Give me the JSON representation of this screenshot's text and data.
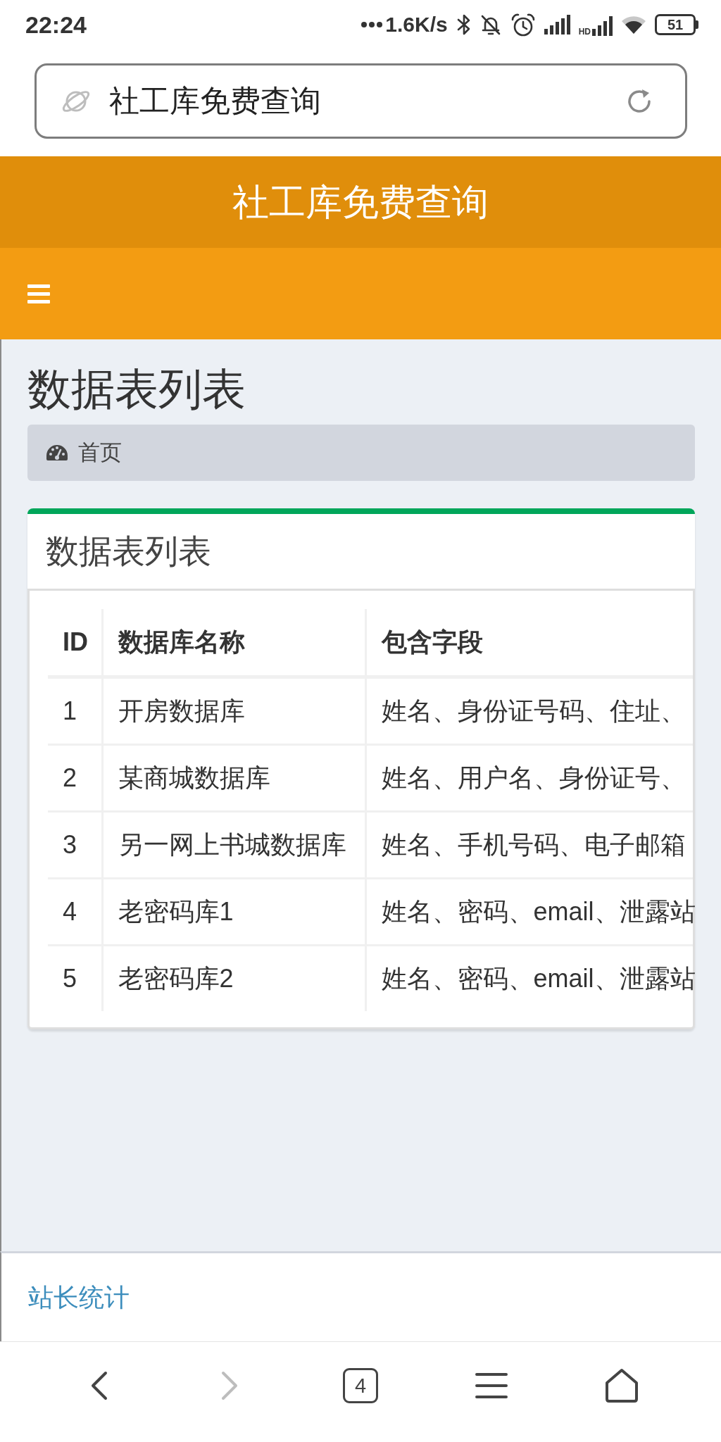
{
  "status_bar": {
    "time": "22:24",
    "network_speed": "1.6K/s",
    "hd_label": "HD",
    "battery": "51"
  },
  "address_bar": {
    "text": "社工库免费查询"
  },
  "header": {
    "title": "社工库免费查询"
  },
  "page": {
    "title": "数据表列表",
    "breadcrumb": [
      {
        "label": "首页"
      }
    ]
  },
  "card": {
    "title": "数据表列表",
    "table": {
      "columns": [
        "ID",
        "数据库名称",
        "包含字段"
      ],
      "rows": [
        [
          "1",
          "开房数据库",
          "姓名、身份证号码、住址、"
        ],
        [
          "2",
          "某商城数据库",
          "姓名、用户名、身份证号、"
        ],
        [
          "3",
          "另一网上书城数据库",
          "姓名、手机号码、电子邮箱"
        ],
        [
          "4",
          "老密码库1",
          "姓名、密码、email、泄露站"
        ],
        [
          "5",
          "老密码库2",
          "姓名、密码、email、泄露站"
        ]
      ]
    }
  },
  "footer": {
    "link": "站长统计"
  },
  "browser_nav": {
    "back": {
      "disabled": false
    },
    "forward": {
      "disabled": true
    },
    "tabs": "4"
  }
}
